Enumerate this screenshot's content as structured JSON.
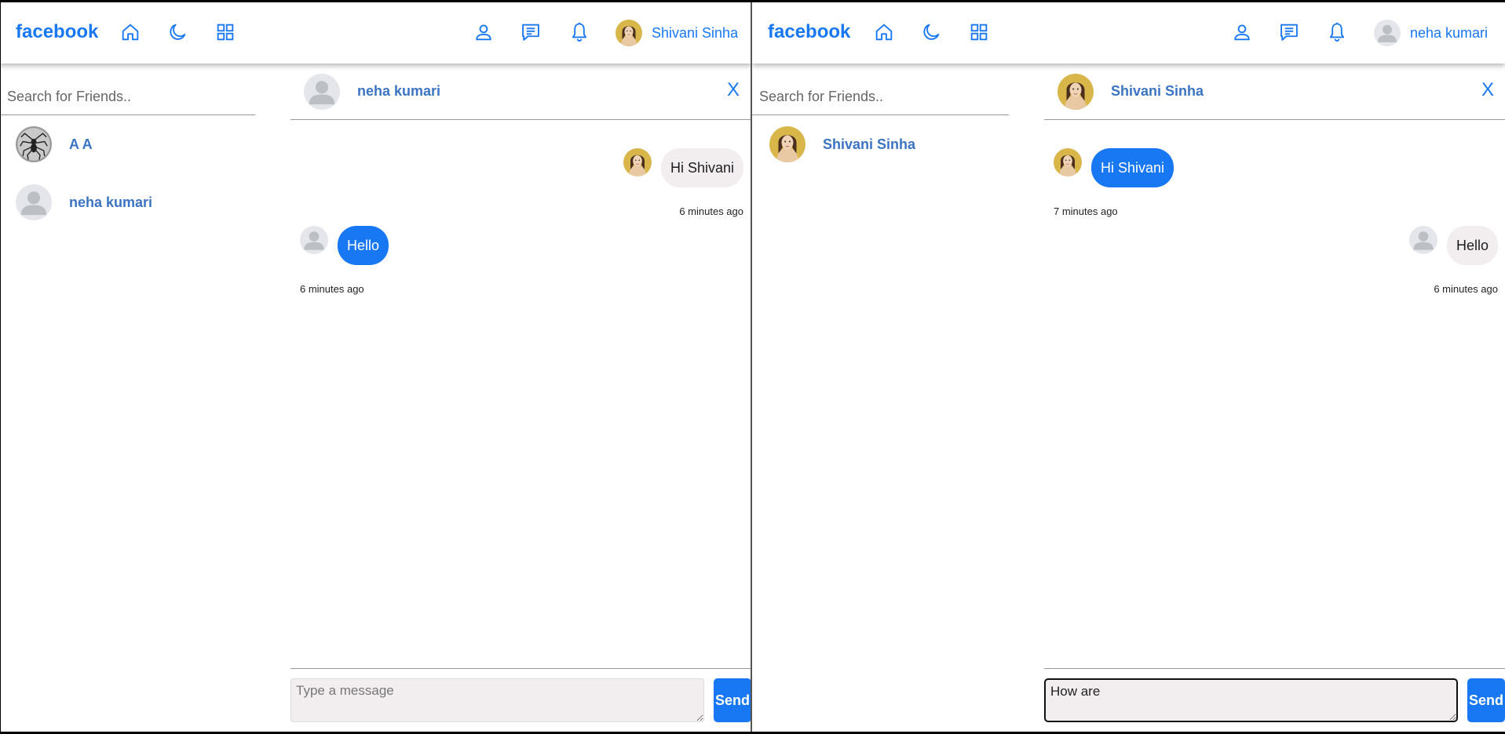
{
  "colors": {
    "brand": "#1877f2",
    "friend_name": "#3b74c2",
    "own_bubble": "#f2eeef",
    "other_bubble": "#1877f2"
  },
  "icons": [
    "home-icon",
    "moon-icon",
    "grid-icon",
    "person-icon",
    "chat-icon",
    "bell-icon",
    "avatar-photo",
    "avatar-placeholder",
    "avatar-spider"
  ],
  "left": {
    "navbar": {
      "logo": "facebook",
      "user_name": "Shivani Sinha"
    },
    "search": {
      "placeholder": "Search for Friends.."
    },
    "friends": [
      {
        "name": "A A"
      },
      {
        "name": "neha kumari"
      }
    ],
    "chat": {
      "title": "neha kumari",
      "close_label": "X",
      "messages": [
        {
          "text": "Hi Shivani",
          "time": "6 minutes ago",
          "own": true
        },
        {
          "text": "Hello",
          "time": "6 minutes ago",
          "own": false
        }
      ],
      "compose": {
        "placeholder": "Type a message",
        "value": "",
        "send_label": "Send"
      }
    }
  },
  "right": {
    "navbar": {
      "logo": "facebook",
      "user_name": "neha kumari"
    },
    "search": {
      "placeholder": "Search for Friends.."
    },
    "friends": [
      {
        "name": "Shivani Sinha"
      }
    ],
    "chat": {
      "title": "Shivani Sinha",
      "close_label": "X",
      "messages": [
        {
          "text": "Hi Shivani",
          "time": "7 minutes ago",
          "own": false
        },
        {
          "text": "Hello",
          "time": "6 minutes ago",
          "own": true
        }
      ],
      "compose": {
        "placeholder": "Type a message",
        "value": "How are",
        "send_label": "Send"
      }
    }
  }
}
